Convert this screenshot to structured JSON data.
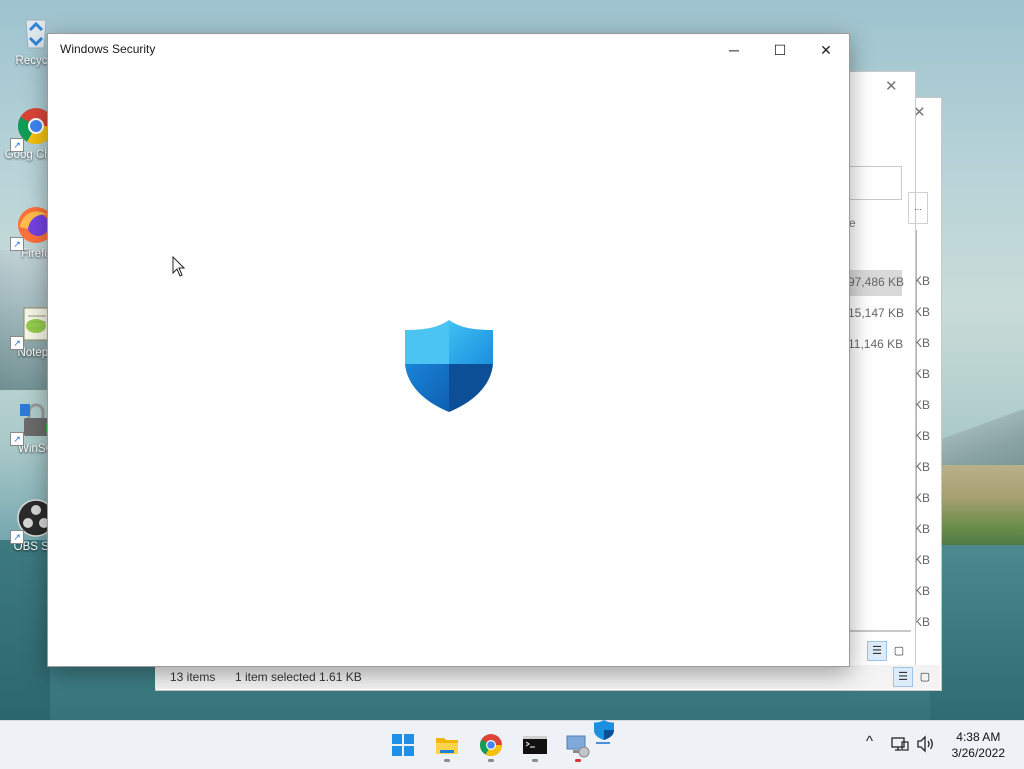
{
  "desktop": {
    "icons": [
      {
        "name": "recycle-bin",
        "label": "Recycle"
      },
      {
        "name": "google-chrome",
        "label": "Goog Chron"
      },
      {
        "name": "firefox",
        "label": "Firefo"
      },
      {
        "name": "notepad",
        "label": "Notepa"
      },
      {
        "name": "winscp",
        "label": "WinSC"
      },
      {
        "name": "obs-studio",
        "label": "OBS Stu"
      }
    ]
  },
  "background_window": {
    "sizes": [
      "97,486 KB",
      "15,147 KB",
      "11,146 KB"
    ],
    "kb_labels": [
      "KB",
      "KB",
      "KB",
      "KB",
      "KB",
      "KB",
      "KB",
      "KB",
      "KB",
      "KB",
      "KB",
      "KB"
    ],
    "partial_text": "e",
    "ellipsis": "...",
    "status": {
      "items": "13 items",
      "selected": "1 item selected  1.61 KB"
    }
  },
  "security_window": {
    "title": "Windows Security",
    "minimize": "─",
    "maximize": "☐",
    "close": "✕",
    "logo_icon": "shield-icon",
    "accent": "#0f6cbd"
  },
  "taskbar": {
    "apps": [
      "start",
      "file-explorer",
      "chrome",
      "terminal",
      "remote-desktop",
      "windows-security"
    ],
    "tray": {
      "chevron": "^",
      "network": "network-icon",
      "volume": "volume-icon"
    },
    "clock": {
      "time": "4:38 AM",
      "date": "3/26/2022"
    }
  }
}
